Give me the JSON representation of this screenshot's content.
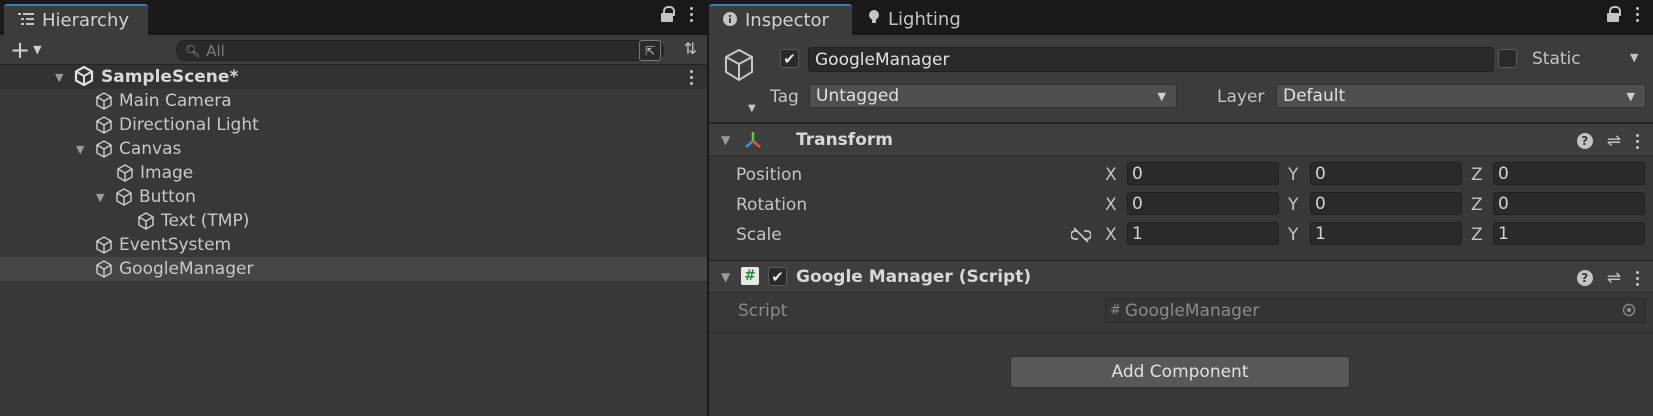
{
  "hierarchy": {
    "tab_label": "Hierarchy",
    "search_placeholder": "All",
    "scene_name": "SampleScene*",
    "items": [
      {
        "label": "Main Camera"
      },
      {
        "label": "Directional Light"
      },
      {
        "label": "Canvas"
      },
      {
        "label": "Image"
      },
      {
        "label": "Button"
      },
      {
        "label": "Text (TMP)"
      },
      {
        "label": "EventSystem"
      },
      {
        "label": "GoogleManager"
      }
    ]
  },
  "inspector": {
    "tabs": [
      {
        "label": "Inspector"
      },
      {
        "label": "Lighting"
      }
    ],
    "object_name": "GoogleManager",
    "static_label": "Static",
    "tag_label": "Tag",
    "tag_value": "Untagged",
    "layer_label": "Layer",
    "layer_value": "Default",
    "transform": {
      "title": "Transform",
      "position": {
        "label": "Position",
        "x": "0",
        "y": "0",
        "z": "0"
      },
      "rotation": {
        "label": "Rotation",
        "x": "0",
        "y": "0",
        "z": "0"
      },
      "scale": {
        "label": "Scale",
        "x": "1",
        "y": "1",
        "z": "1"
      },
      "axis": {
        "x": "X",
        "y": "Y",
        "z": "Z"
      }
    },
    "script_component": {
      "title": "Google Manager (Script)",
      "script_label": "Script",
      "script_value": "GoogleManager"
    },
    "add_component_label": "Add Component"
  }
}
